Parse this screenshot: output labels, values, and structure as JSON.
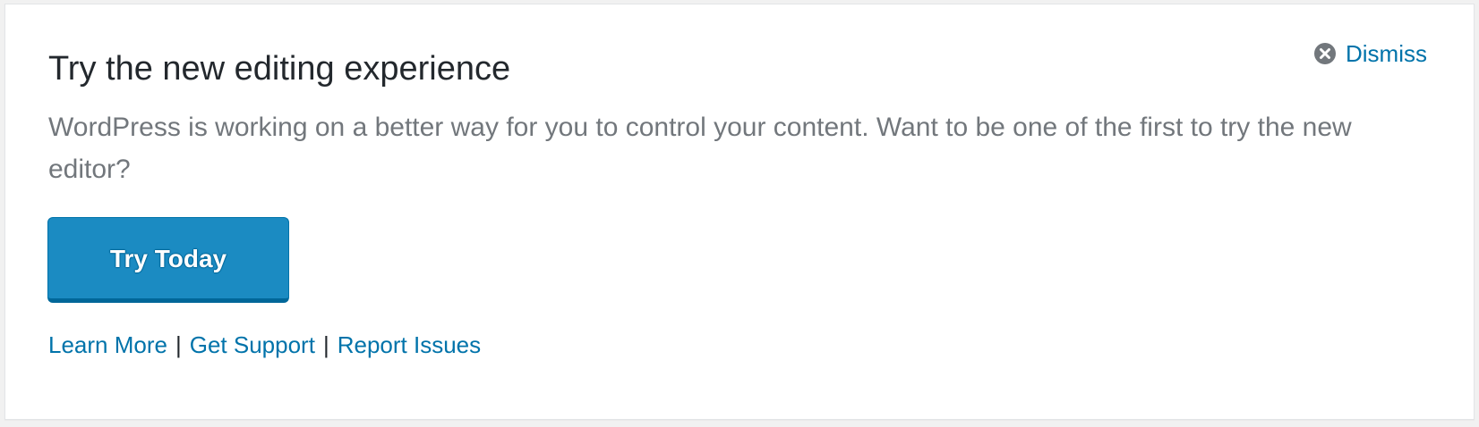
{
  "notice": {
    "title": "Try the new editing experience",
    "description": "WordPress is working on a better way for you to control your content. Want to be one of the first to try the new editor?",
    "dismiss_label": "Dismiss",
    "dismiss_icon": "close-circle-icon",
    "button_label": "Try Today",
    "links": [
      {
        "label": "Learn More"
      },
      {
        "label": "Get Support"
      },
      {
        "label": "Report Issues"
      }
    ],
    "separator": "|",
    "colors": {
      "link": "#0073aa",
      "button": "#1b8bc2",
      "button_border": "#006799",
      "title": "#23282d",
      "body_text": "#72777c",
      "dismiss_icon": "#72777c"
    }
  }
}
